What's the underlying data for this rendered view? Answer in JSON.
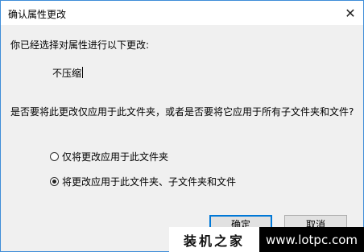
{
  "dialog": {
    "title": "确认属性更改",
    "close_glyph": "✕",
    "prompt": "你已经选择对属性进行以下更改:",
    "attribute_value": "不压缩",
    "question": "是否要将此更改仅应用于此文件夹，或者是否要将它应用于所有子文件夹和文件?",
    "options": [
      {
        "label": "仅将更改应用于此文件夹",
        "selected": false
      },
      {
        "label": "将更改应用于此文件夹、子文件夹和文件",
        "selected": true
      }
    ],
    "ok_label": "确定",
    "cancel_label": "取消"
  },
  "watermark": {
    "site_name": "装机之家",
    "site_url": "www.lotpc.com"
  }
}
